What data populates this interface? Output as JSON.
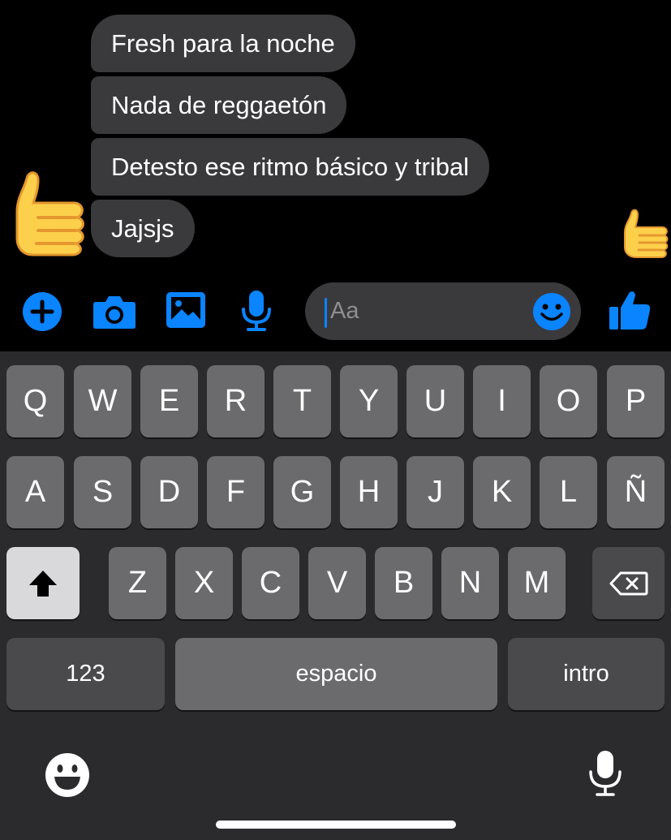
{
  "messages": [
    {
      "text": "Fresh para la noche"
    },
    {
      "text": "Nada de reggaetón"
    },
    {
      "text": "Detesto ese ritmo básico y tribal"
    },
    {
      "text": "Jajsjs"
    }
  ],
  "composer": {
    "placeholder": "Aa",
    "icons": [
      "plus-icon",
      "camera-icon",
      "image-icon",
      "microphone-icon",
      "emoji-icon",
      "thumbs-up-icon"
    ]
  },
  "keyboard": {
    "row1": [
      "Q",
      "W",
      "E",
      "R",
      "T",
      "Y",
      "U",
      "I",
      "O",
      "P"
    ],
    "row2": [
      "A",
      "S",
      "D",
      "F",
      "G",
      "H",
      "J",
      "K",
      "L",
      "Ñ"
    ],
    "row3": [
      "Z",
      "X",
      "C",
      "V",
      "B",
      "N",
      "M"
    ],
    "numbers_label": "123",
    "space_label": "espacio",
    "return_label": "intro"
  },
  "colors": {
    "accent": "#0a84ff",
    "bubble": "#3a3a3c",
    "keyboard_bg": "#2b2b2d",
    "key": "#6b6b6d",
    "key_dark": "#4a4a4c"
  }
}
